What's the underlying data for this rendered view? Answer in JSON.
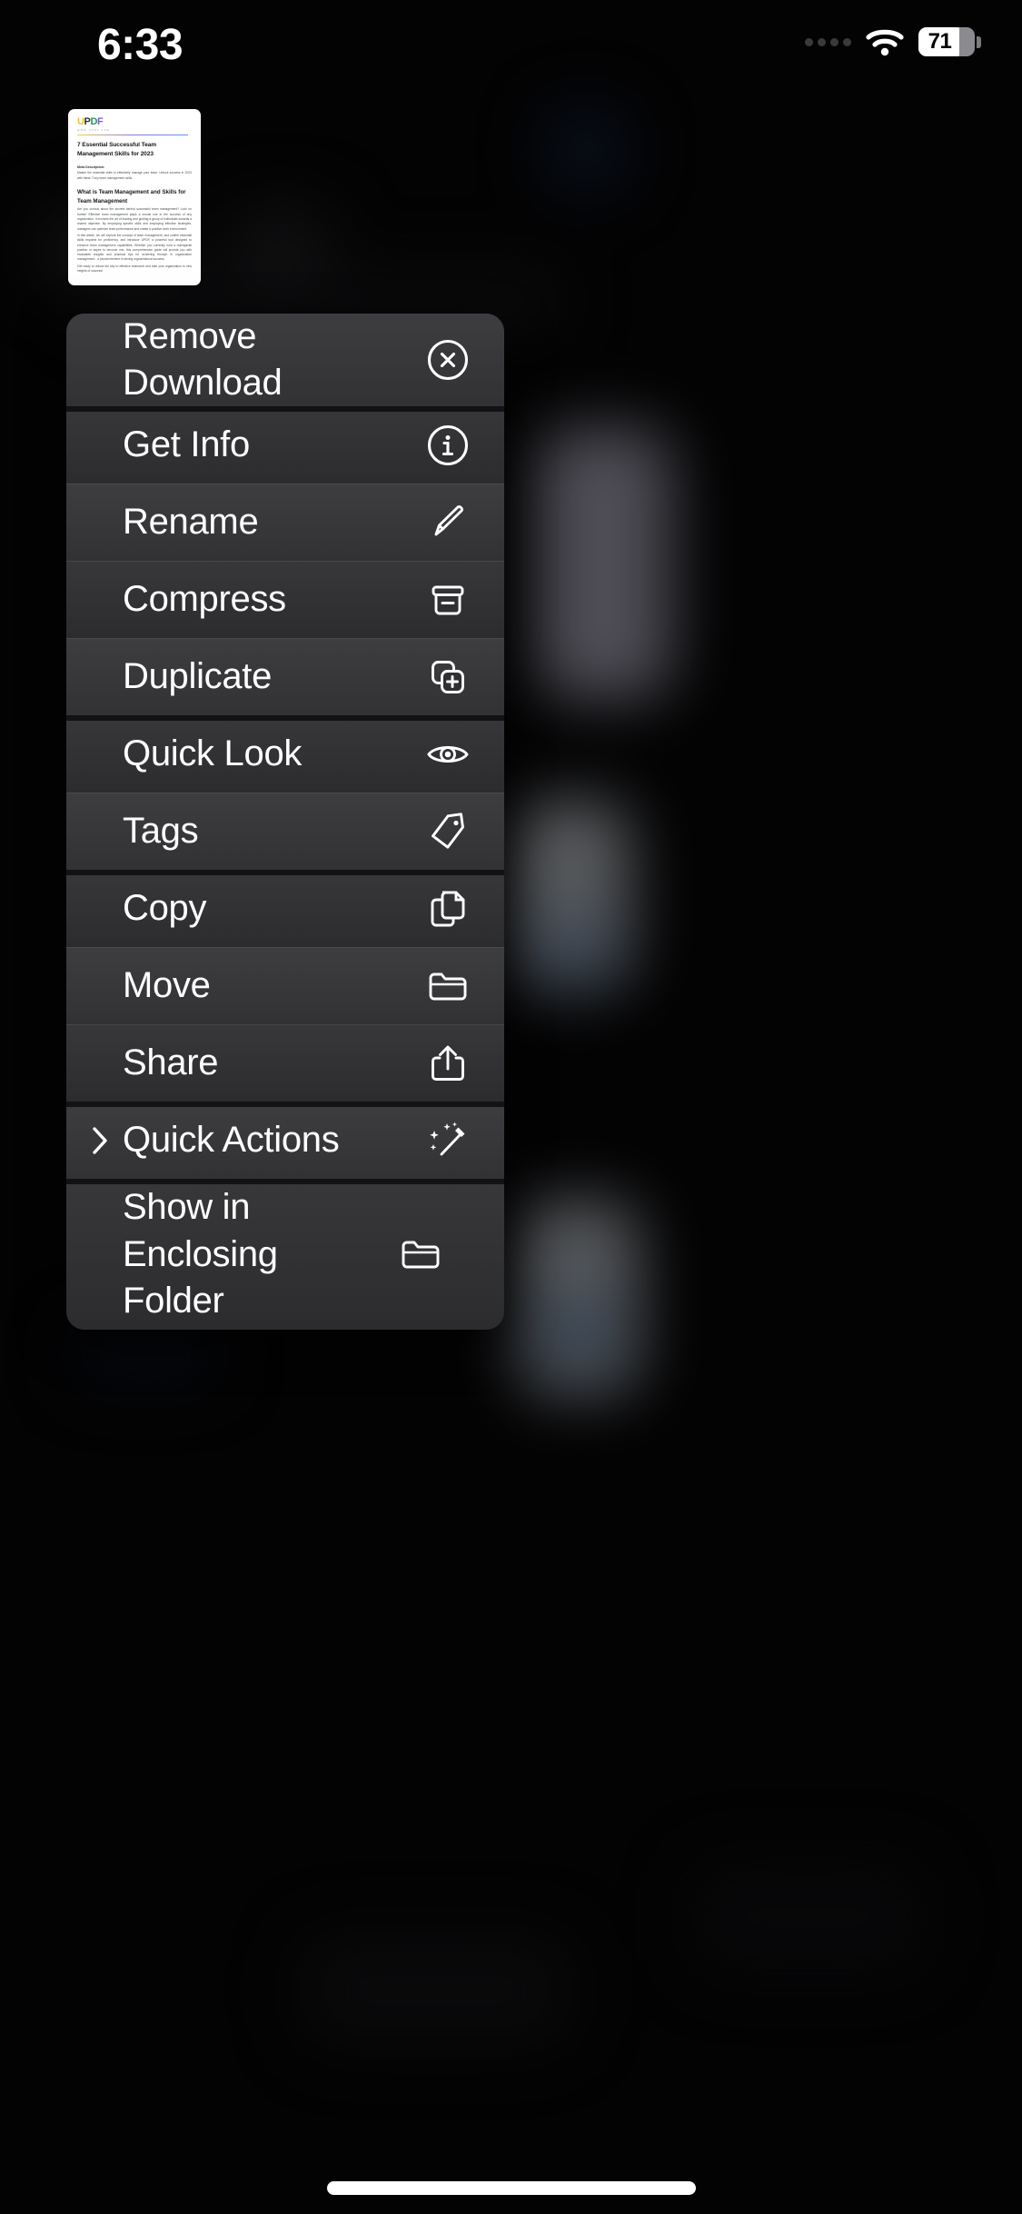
{
  "status_bar": {
    "time": "6:33",
    "battery_percent": "71",
    "icons": [
      "signal-dots-icon",
      "wifi-icon",
      "battery-icon"
    ]
  },
  "thumbnail": {
    "logo_letters": [
      "U",
      "P",
      "D",
      "F"
    ],
    "logo_subtitle": "WWW.UPDF.COM",
    "title": "7 Essential Successful Team Management Skills for 2023",
    "meta_label": "Meta Description:",
    "meta_text": "Master the essential skills to effectively manage your team. Unlock success in 2023 with these 7 key team management skills.",
    "heading_2": "What is Team Management and Skills for Team Management",
    "body_1": "Are you curious about the secrets behind successful team management? Look no further! Effective team management plays a crucial role in the success of any organization. It involves the art of leading and guiding a group of individuals towards a shared objective. By employing specific skills and employing effective strategies, managers can optimize team performance and create a positive work environment.",
    "body_2": "In this article, we will explore the concept of team management, and outline essential skills required for proficiency, and introduce UPDF, a powerful tool designed to enhance team management capabilities. Whether you currently hold a managerial position or aspire to become one, this comprehensive guide will provide you with invaluable insights and practical tips for achieving triumph in organization management - a pivotal element in driving organizational success.",
    "body_3": "Get ready to unlock the key to effective teamwork and take your organization to new heights of success!"
  },
  "context_menu": {
    "items": [
      {
        "label": "Remove Download",
        "icon": "x-circle-icon",
        "has_submenu": false
      },
      {
        "label": "Get Info",
        "icon": "info-circle-icon",
        "has_submenu": false
      },
      {
        "label": "Rename",
        "icon": "pencil-icon",
        "has_submenu": false
      },
      {
        "label": "Compress",
        "icon": "archive-box-icon",
        "has_submenu": false
      },
      {
        "label": "Duplicate",
        "icon": "duplicate-plus-icon",
        "has_submenu": false
      },
      {
        "label": "Quick Look",
        "icon": "eye-icon",
        "has_submenu": false
      },
      {
        "label": "Tags",
        "icon": "tag-icon",
        "has_submenu": false
      },
      {
        "label": "Copy",
        "icon": "copy-docs-icon",
        "has_submenu": false
      },
      {
        "label": "Move",
        "icon": "folder-icon",
        "has_submenu": false
      },
      {
        "label": "Share",
        "icon": "share-arrow-icon",
        "has_submenu": false
      },
      {
        "label": "Quick Actions",
        "icon": "magic-wand-icon",
        "has_submenu": true
      },
      {
        "label": "Show in Enclosing Folder",
        "icon": "folder-icon",
        "has_submenu": false
      }
    ]
  },
  "colors": {
    "background": "#08080a",
    "menu_surface": "#303032",
    "text_primary": "#ffffff",
    "separator": "rgba(255,255,255,0.075)",
    "home_indicator": "#ffffff"
  },
  "home_indicator": {
    "label": "home-indicator"
  }
}
